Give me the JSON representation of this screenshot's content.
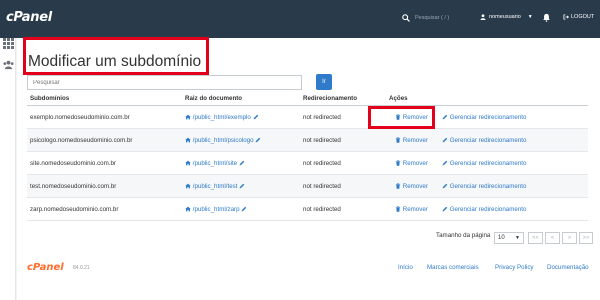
{
  "header": {
    "logo": "cPanel",
    "search_placeholder": "Pesquisar ( / )",
    "username": "nomeusuario",
    "logout_label": "LOGOUT"
  },
  "page": {
    "title": "Modificar um subdomínio",
    "search_placeholder": "Pesquisar",
    "go_label": "Ir"
  },
  "table": {
    "headers": [
      "Subdomínios",
      "Raiz do documento",
      "Redirecionamento",
      "Ações"
    ],
    "remove_label": "Remover",
    "manage_label": "Gerenciar redirecionamento",
    "rows": [
      {
        "subdomain": "exemplo.nomedoseudominio.com.br",
        "docroot": "/public_html/exemplo",
        "redirect": "not redirected"
      },
      {
        "subdomain": "psicologo.nomedoseudominio.com.br",
        "docroot": "/public_html/psicologo",
        "redirect": "not redirected"
      },
      {
        "subdomain": "site.nomedoseudominio.com.br",
        "docroot": "/public_html/site",
        "redirect": "not redirected"
      },
      {
        "subdomain": "test.nomedoseudominio.com.br",
        "docroot": "/public_html/test",
        "redirect": "not redirected"
      },
      {
        "subdomain": "zarp.nomedoseudominio.com.br",
        "docroot": "/public_html/zarp",
        "redirect": "not redirected"
      }
    ]
  },
  "pagination": {
    "page_size_label": "Tamanho da página",
    "page_size": "10",
    "buttons": [
      "<<",
      "<",
      ">",
      ">>"
    ]
  },
  "footer": {
    "logo": "cPanel",
    "version": "84.0.21",
    "links": [
      "Início",
      "Marcas comerciais",
      "Privacy Policy",
      "Documentação"
    ]
  },
  "colors": {
    "topbar": "#293a4a",
    "accent": "#2f7ac9",
    "brand_orange": "#ff6c2c",
    "highlight_red": "#e3001b"
  }
}
